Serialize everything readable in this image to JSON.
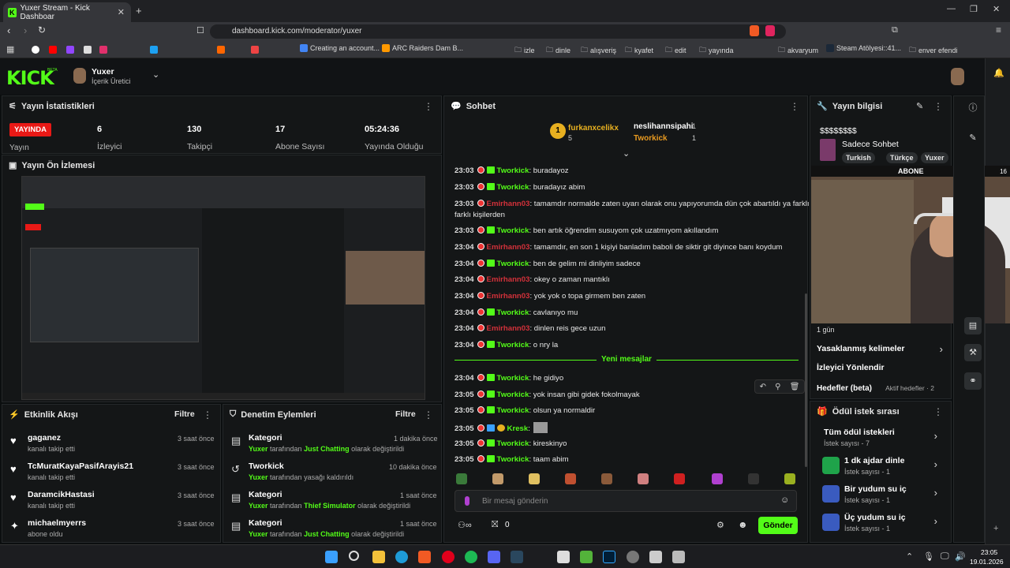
{
  "browser": {
    "tab_title": "Yuxer Stream - Kick Dashboar",
    "url": "dashboard.kick.com/moderator/yuxer"
  },
  "bookmarks": [
    "Creating an account...",
    "ARC Raiders Dam B...",
    "izle",
    "dinle",
    "alışveriş",
    "kyafet",
    "edit",
    "yayında",
    "akvaryum",
    "Steam Atölyesi::41...",
    "enver efendi"
  ],
  "header": {
    "logo": "KICK",
    "logo_beta": "BETA",
    "username": "Yuxer",
    "role": "İçerik Üretici"
  },
  "stats_panel": {
    "title": "Yayın İstatistikleri",
    "live_badge": "YAYINDA",
    "live_label": "Yayın",
    "values": [
      {
        "v": "6",
        "l": "İzleyici"
      },
      {
        "v": "130",
        "l": "Takipçi"
      },
      {
        "v": "17",
        "l": "Abone Sayısı"
      },
      {
        "v": "05:24:36",
        "l": "Yayında Olduğu"
      }
    ]
  },
  "preview_panel": {
    "title": "Yayın Ön İzlemesi"
  },
  "activity": {
    "title": "Etkinlik Akışı",
    "filter": "Filtre",
    "items": [
      {
        "name": "gaganez",
        "desc": "kanalı takip etti",
        "ago": "3 saat önce"
      },
      {
        "name": "TcMuratKayaPasifArayis21",
        "desc": "kanalı takip etti",
        "ago": "3 saat önce"
      },
      {
        "name": "DaramcikHastasi",
        "desc": "kanalı takip etti",
        "ago": "3 saat önce"
      },
      {
        "name": "michaelmyerrs",
        "desc": "abone oldu",
        "ago": "3 saat önce"
      }
    ]
  },
  "modlog": {
    "title": "Denetim Eylemleri",
    "filter": "Filtre",
    "items": [
      {
        "name": "Kategori",
        "by": "Yuxer",
        "mid": " tarafından ",
        "hl": "Just Chatting",
        "tail": " olarak değiştirildi",
        "ago": "1 dakika önce"
      },
      {
        "name": "Tworkick",
        "by": "Yuxer",
        "mid": " tarafından yasağı kaldırıldı",
        "hl": "",
        "tail": "",
        "ago": "10 dakika önce"
      },
      {
        "name": "Kategori",
        "by": "Yuxer",
        "mid": " tarafından ",
        "hl": "Thief Simulator",
        "tail": " olarak değiştirildi",
        "ago": "1 saat önce"
      },
      {
        "name": "Kategori",
        "by": "Yuxer",
        "mid": " tarafından ",
        "hl": "Just Chatting",
        "tail": " olarak değiştirildi",
        "ago": "1 saat önce"
      }
    ]
  },
  "chat": {
    "title": "Sohbet",
    "top1": "furkanxcelikx",
    "top1_count": "5",
    "top2": "neslihannsipahi",
    "top2_count": "1",
    "top3": "Tworkick",
    "top3_count": "1",
    "new_messages": "Yeni mesajlar",
    "placeholder": "Bir mesaj gönderin",
    "send": "Gönder",
    "points": "0",
    "messages": [
      {
        "t": "23:03",
        "u": "Tworkick",
        "c": "u1",
        "m": ": buradayoz"
      },
      {
        "t": "23:03",
        "u": "Tworkick",
        "c": "u1",
        "m": ": buradayız abim"
      },
      {
        "t": "23:03",
        "u": "Emirhann03",
        "c": "u2",
        "m": ": tamamdır normalde zaten uyarı olarak onu yapıyorumda dün çok abartıldı ya farklı"
      },
      {
        "t": "",
        "u": "",
        "c": "",
        "m": "farklı kişilerden"
      },
      {
        "t": "23:03",
        "u": "Tworkick",
        "c": "u1",
        "m": ": ben artık öğrendim susuyom çok uzatmıyom akıllandım"
      },
      {
        "t": "23:04",
        "u": "Emirhann03",
        "c": "u2",
        "m": ": tamamdır, en son 1 kişiyi banladım baboli de siktir git diyince banı koydum"
      },
      {
        "t": "23:04",
        "u": "Tworkick",
        "c": "u1",
        "m": ": ben de gelim mi dinliyim sadece"
      },
      {
        "t": "23:04",
        "u": "Emirhann03",
        "c": "u2",
        "m": ": okey o zaman mantıklı"
      },
      {
        "t": "23:04",
        "u": "Emirhann03",
        "c": "u2",
        "m": ": yok yok o topa girmem ben zaten"
      },
      {
        "t": "23:04",
        "u": "Tworkick",
        "c": "u1",
        "m": ": cavlanıyo mu"
      },
      {
        "t": "23:04",
        "u": "Emirhann03",
        "c": "u2",
        "m": ": dinlen reis gece uzun"
      },
      {
        "t": "23:04",
        "u": "Tworkick",
        "c": "u1",
        "m": ": o nry la"
      },
      {
        "t": "23:04",
        "u": "Tworkick",
        "c": "u1",
        "m": ": he gidiyo"
      },
      {
        "t": "23:05",
        "u": "Tworkick",
        "c": "u1",
        "m": ": yok insan gibi gidek fokolmayak"
      },
      {
        "t": "23:05",
        "u": "Tworkick",
        "c": "u1",
        "m": ": olsun ya normaldir"
      },
      {
        "t": "23:05",
        "u": "Kresk",
        "c": "u3",
        "m": ":"
      },
      {
        "t": "23:05",
        "u": "Tworkick",
        "c": "u1",
        "m": ": kireskinyo"
      },
      {
        "t": "23:05",
        "u": "Tworkick",
        "c": "u1",
        "m": ": taam abim"
      }
    ]
  },
  "info": {
    "title": "Yayın bilgisi",
    "stream_title": "$$$$$$$$",
    "category": "Sadece Sohbet",
    "tags": [
      "Turkish",
      "Türkçe",
      "Yuxer"
    ],
    "sub_banner": "ABONE",
    "sub_count": "16",
    "duration": "1 gün",
    "banned_words": "Yasaklanmış kelimeler",
    "viewer_dir": "İzleyici Yönlendir",
    "goals": "Hedefler (beta)",
    "goals_sub": "Aktif hedefler · 2"
  },
  "rewards": {
    "title": "Ödül istek sırası",
    "items": [
      {
        "label": "Tüm ödül istekleri",
        "sub": "İstek sayısı - 7",
        "color": ""
      },
      {
        "label": "1 dk ajdar dinle",
        "sub": "İstek sayısı - 1",
        "color": "#1fa34a"
      },
      {
        "label": "Bir yudum su iç",
        "sub": "İstek sayısı - 1",
        "color": "#3a5bbf"
      },
      {
        "label": "Üç yudum su iç",
        "sub": "İstek sayısı - 1",
        "color": "#3a5bbf"
      }
    ]
  },
  "clock": {
    "time": "23:05",
    "date": "19.01.2026"
  },
  "accent": "#53fc18"
}
